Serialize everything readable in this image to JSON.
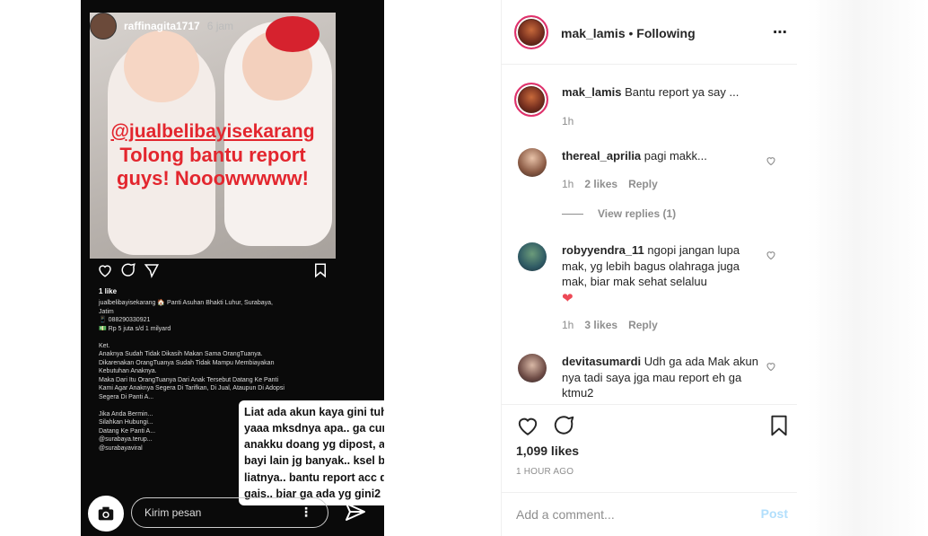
{
  "story": {
    "username": "raffinagita1717",
    "time": "6 jam",
    "overlay_handle": "@jualbelibayisekarang",
    "overlay_line2": "Tolong bantu report",
    "overlay_line3": "guys! Nooowwwww!",
    "likes": "1 like",
    "caption": "jualbelibayisekarang 🏠 Panti Asuhan Bhakti Luhur, Surabaya,\nJatim\n📱 088290330921\n💵 Rp 5 juta s/d 1 milyard\n\nKet.\nAnaknya Sudah Tidak Dikasih Makan Sama OrangTuanya.\nDikarenakan OrangTuanya Sudah Tidak Mampu Membiayakan\nKebutuhan Anaknya.\nMaka Dari Itu OrangTuanya Dari Anak Tersebut Datang Ke Panti\nKami Agar Anaknya Segera Di Tarifkan, Di Jual, Ataupun Di Adopsi\nSegera Di Panti A...\n\nJika Anda Bermin...\nSilahkan Hubungi...\nDatang Ke Panti A...\n@surabaya.terup...\n@surabayaviral",
    "bubble_text": "Liat ada akun kaya gini tuh gila sih yaaa mksdnya apa.. ga cuma foto anakku doang yg dipost, ada foto bayi lain jg banyak.. ksel bgt sih ini  liatnya.. bantu report acc dongg gais.. biar ga ada yg gini2 lagi...😞",
    "reply_placeholder": "Kirim pesan"
  },
  "header": {
    "username": "mak_lamis",
    "separator": "•",
    "follow_state": "Following",
    "more_icon": "⋯"
  },
  "caption": {
    "username": "mak_lamis",
    "text": "Bantu report ya say ...",
    "time": "1h"
  },
  "comments": [
    {
      "username": "thereal_aprilia",
      "text": "pagi makk...",
      "time": "1h",
      "likes": "2 likes",
      "reply": "Reply",
      "view_replies": "View replies (1)"
    },
    {
      "username": "robyyendra_11",
      "text": "ngopi jangan lupa mak, yg lebih bagus olahraga juga mak, biar mak sehat selaluu",
      "emoji": "❤",
      "time": "1h",
      "likes": "3 likes",
      "reply": "Reply"
    },
    {
      "username": "devitasumardi",
      "text": "Udh ga ada Mak akun nya tadi saya jga mau report eh ga ktmu2"
    }
  ],
  "likes_count": "1,099 likes",
  "time_ago": "1 HOUR AGO",
  "add_comment": {
    "placeholder": "Add a comment...",
    "post_label": "Post"
  },
  "colors": {
    "accent_link": "#b2dffc",
    "overlay_red": "#e3262e",
    "heart_red": "#ed4956",
    "muted": "#8e8e8e"
  }
}
